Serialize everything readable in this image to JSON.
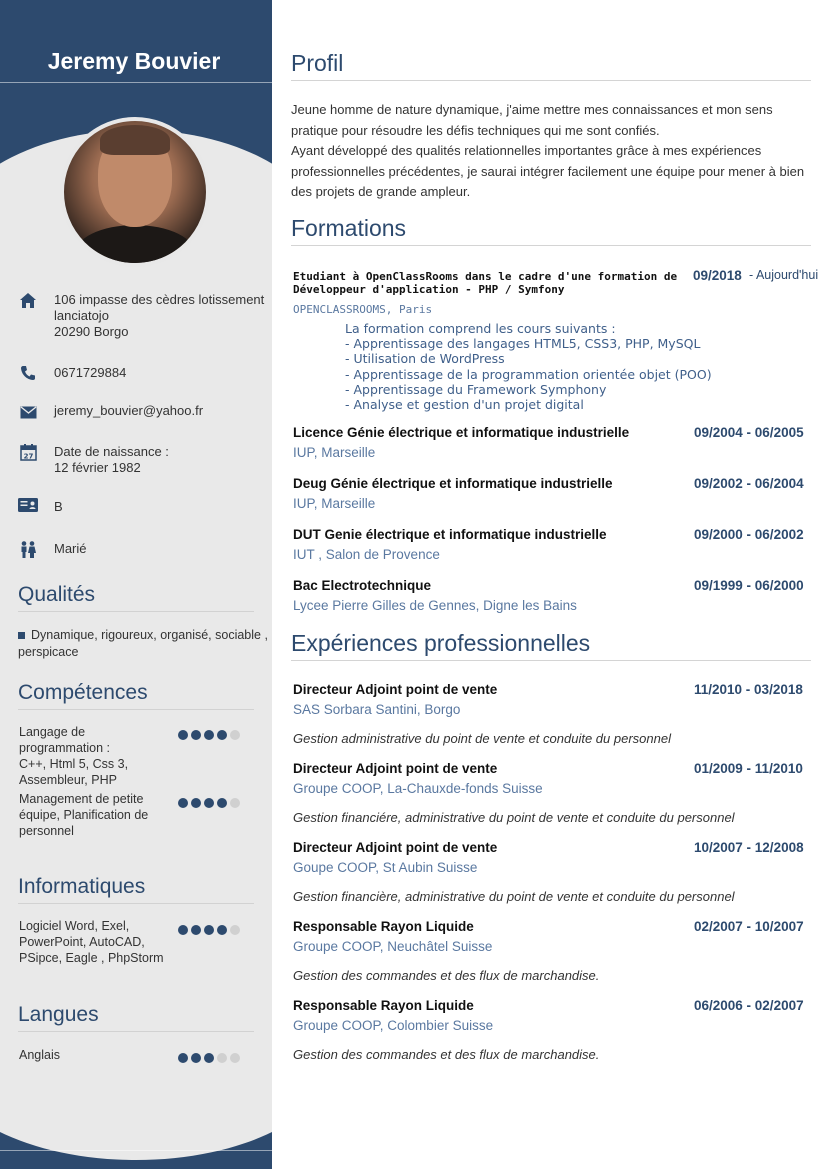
{
  "person": {
    "name": "Jeremy Bouvier"
  },
  "contact": {
    "address": "106 impasse des cèdres lotissement lanciatojo\n20290 Borgo",
    "phone": "0671729884",
    "email": "jeremy_bouvier@yahoo.fr",
    "birth": "Date de naissance :\n12 février 1982",
    "license": "B",
    "status": "Marié"
  },
  "sidebar": {
    "qualites_title": "Qualités",
    "qualites_text": "Dynamique, rigoureux, organisé, sociable , perspicace",
    "competences_title": "Compétences",
    "competences": [
      {
        "label": "Langage de programmation :\nC++, Html 5, Css 3, Assembleur, PHP",
        "level": 4,
        "max": 5
      },
      {
        "label": "Management de petite équipe, Planification de personnel",
        "level": 4,
        "max": 5
      }
    ],
    "informatiques_title": "Informatiques",
    "informatiques": [
      {
        "label": "Logiciel Word, Exel, PowerPoint, AutoCAD, PSipce, Eagle , PhpStorm",
        "level": 4,
        "max": 5
      }
    ],
    "langues_title": "Langues",
    "langues": [
      {
        "label": "Anglais",
        "level": 3,
        "max": 5
      }
    ]
  },
  "profil": {
    "title": "Profil",
    "text": "Jeune homme de nature dynamique, j'aime mettre mes connaissances et mon sens pratique pour résoudre les défis techniques qui me sont confiés.\nAyant développé des qualités relationnelles importantes  grâce à mes expériences professionnelles précédentes, je saurai intégrer facilement une équipe pour mener à bien des projets de grande ampleur."
  },
  "formations": {
    "title": "Formations",
    "openclassrooms": {
      "title": "Etudiant à OpenClassRooms dans le cadre d'une formation de Développeur d'application - PHP / Symfony",
      "date_start": "09/2018",
      "date_end": "- Aujourd'hui",
      "school": "OPENCLASSROOMS, Paris",
      "courses": [
        "La formation comprend les cours suivants :",
        "- Apprentissage des langages HTML5, CSS3, PHP, MySQL",
        "- Utilisation de WordPress",
        "- Apprentissage de la programmation orientée objet (POO)",
        "- Apprentissage du Framework Symphony",
        "- Analyse et gestion d'un projet digital"
      ]
    },
    "items": [
      {
        "title": "Licence Génie électrique et informatique industrielle",
        "date": "09/2004 - 06/2005",
        "school": "IUP, Marseille"
      },
      {
        "title": "Deug Génie électrique et informatique industrielle",
        "date": "09/2002 - 06/2004",
        "school": "IUP, Marseille"
      },
      {
        "title": "DUT Genie électrique et informatique industrielle",
        "date": "09/2000 - 06/2002",
        "school": "IUT , Salon de Provence"
      },
      {
        "title": "Bac Electrotechnique",
        "date": "09/1999 - 06/2000",
        "school": "Lycee Pierre Gilles de Gennes, Digne les Bains"
      }
    ]
  },
  "experiences": {
    "title": "Expériences professionnelles",
    "items": [
      {
        "title": "Directeur Adjoint point de vente",
        "date": "11/2010 - 03/2018",
        "company": "SAS Sorbara Santini, Borgo",
        "desc": "Gestion administrative du point de vente et conduite du personnel"
      },
      {
        "title": "Directeur Adjoint point de vente",
        "date": "01/2009 - 11/2010",
        "company": "Groupe COOP, La-Chauxde-fonds Suisse",
        "desc": "Gestion financiére, administrative du point de vente et conduite du personnel"
      },
      {
        "title": "Directeur Adjoint point de vente",
        "date": "10/2007 - 12/2008",
        "company": "Goupe COOP, St Aubin Suisse",
        "desc": "Gestion financière, administrative du point de vente et conduite du personnel"
      },
      {
        "title": "Responsable Rayon Liquide",
        "date": "02/2007 - 10/2007",
        "company": "Groupe COOP, Neuchâtel Suisse",
        "desc": "Gestion des commandes et des flux de marchandise."
      },
      {
        "title": "Responsable Rayon Liquide",
        "date": "06/2006 - 02/2007",
        "company": "Groupe COOP, Colombier Suisse",
        "desc": "Gestion des commandes et des flux de marchandise."
      }
    ]
  },
  "icons": {
    "address": "home-icon",
    "phone": "phone-icon",
    "email": "envelope-icon",
    "birth": "calendar-icon",
    "license": "id-card-icon",
    "status": "couple-icon"
  },
  "colors": {
    "primary": "#2d4a6e",
    "sidebar_bg": "#e9e9e9",
    "accent_text": "#5a78a0"
  }
}
